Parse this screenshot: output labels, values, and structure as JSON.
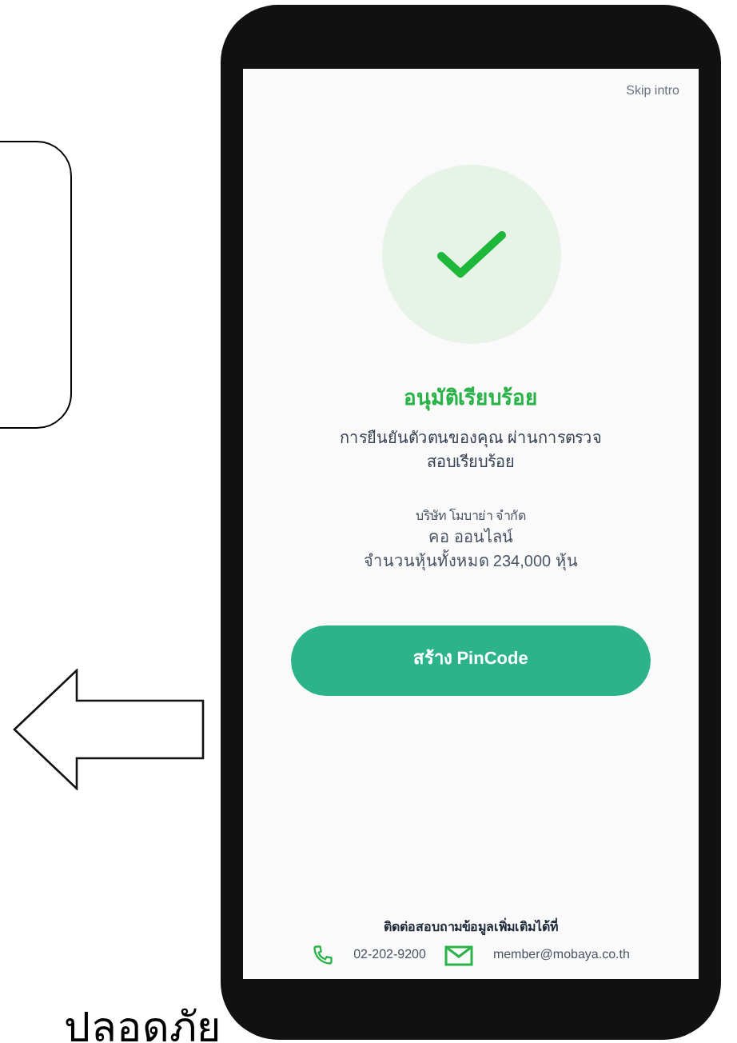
{
  "screen": {
    "top_link": "Skip intro",
    "title": "อนุมัติเรียบร้อย",
    "message": "การยืนยันตัวตนของคุณ ผ่านการตรวจสอบเรียบร้อย",
    "company": "บริษัท โมบาย่า จำกัด",
    "name": "คอ ออนไลน์",
    "shares": "จำนวนหุ้นทั้งหมด 234,000 หุ้น",
    "button": "สร้าง PinCode",
    "contact_title": "ติดต่อสอบถามข้อมูลเพิ่มเติมได้ที่",
    "phone": "02-202-9200",
    "email": "member@mobaya.co.th"
  },
  "caption": "ปลอดภัย"
}
